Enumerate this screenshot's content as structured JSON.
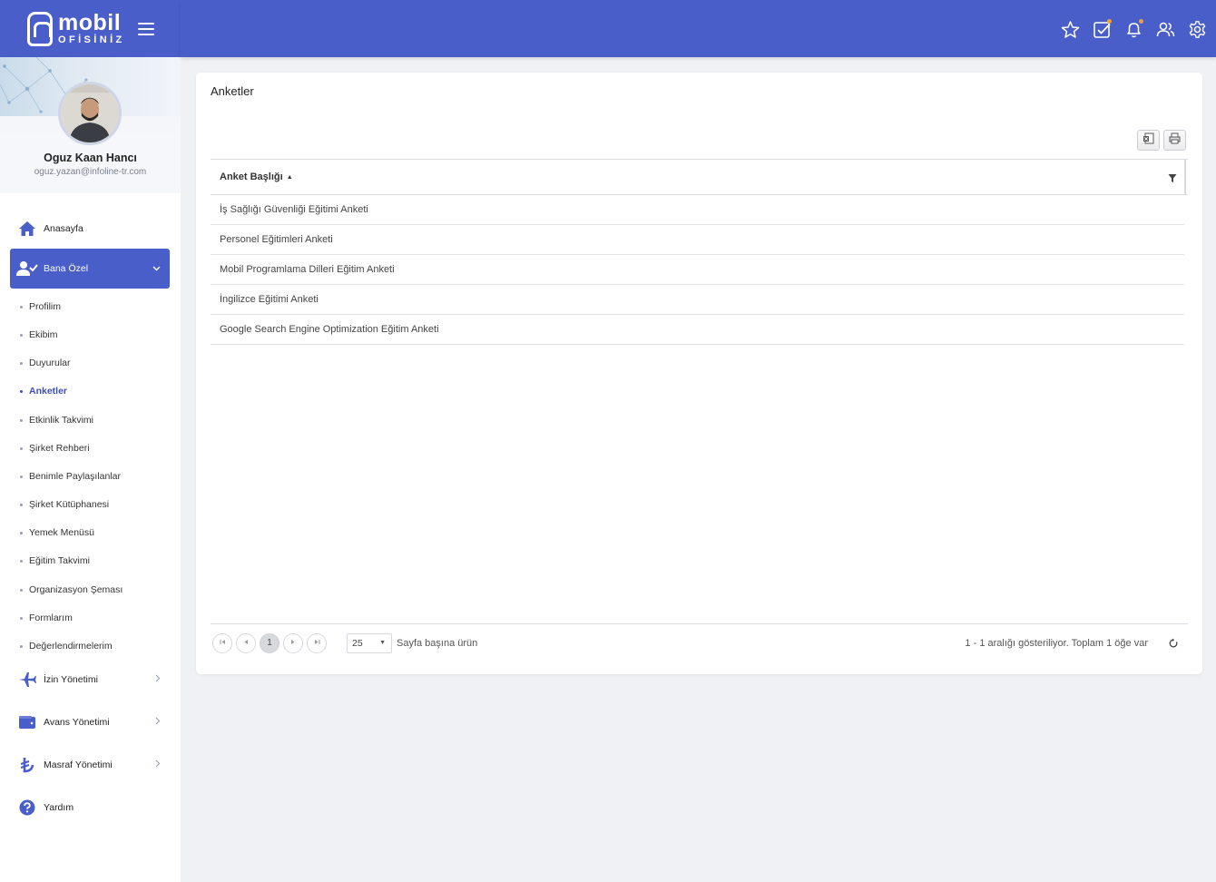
{
  "app": {
    "logo_main": "mobil",
    "logo_sub": "OFİSİNİZ"
  },
  "user": {
    "name": "Oguz Kaan Hancı",
    "email": "oguz.yazan@infoline-tr.com"
  },
  "nav": {
    "home": "Anasayfa",
    "personal": "Bana Özel",
    "sub": [
      "Profilim",
      "Ekibim",
      "Duyurular",
      "Anketler",
      "Etkinlik Takvimi",
      "Şirket Rehberi",
      "Benimle Paylaşılanlar",
      "Şirket Kütüphanesi",
      "Yemek Menüsü",
      "Eğitim Takvimi",
      "Organizasyon Şeması",
      "Formlarım",
      "Değerlendirmelerim"
    ],
    "leave": "İzin Yönetimi",
    "advance": "Avans Yönetimi",
    "expense": "Masraf Yönetimi",
    "help": "Yardım"
  },
  "page": {
    "title": "Anketler",
    "column_header": "Anket Başlığı",
    "rows": [
      "İş Sağlığı Güvenliği Eğitimi Anketi",
      "Personel Eğitimleri Anketi",
      "Mobil Programlama Dilleri Eğitim Anketi",
      "İngilizce Eğitimi Anketi",
      "Google Search Engine Optimization Eğitim Anketi"
    ]
  },
  "pager": {
    "current_page": "1",
    "page_size": "25",
    "page_size_label": "Sayfa başına ürün",
    "info": "1 - 1 aralığı gösteriliyor. Toplam 1 öğe var"
  },
  "colors": {
    "brand": "#4a5ec9",
    "background": "#f0f1f4",
    "notification_dot": "#f0a23a"
  },
  "icons": {
    "topbar": [
      "star-icon",
      "task-check-icon",
      "bell-icon",
      "users-icon",
      "gear-icon"
    ],
    "toolbar": [
      "excel-export-icon",
      "print-icon"
    ]
  }
}
